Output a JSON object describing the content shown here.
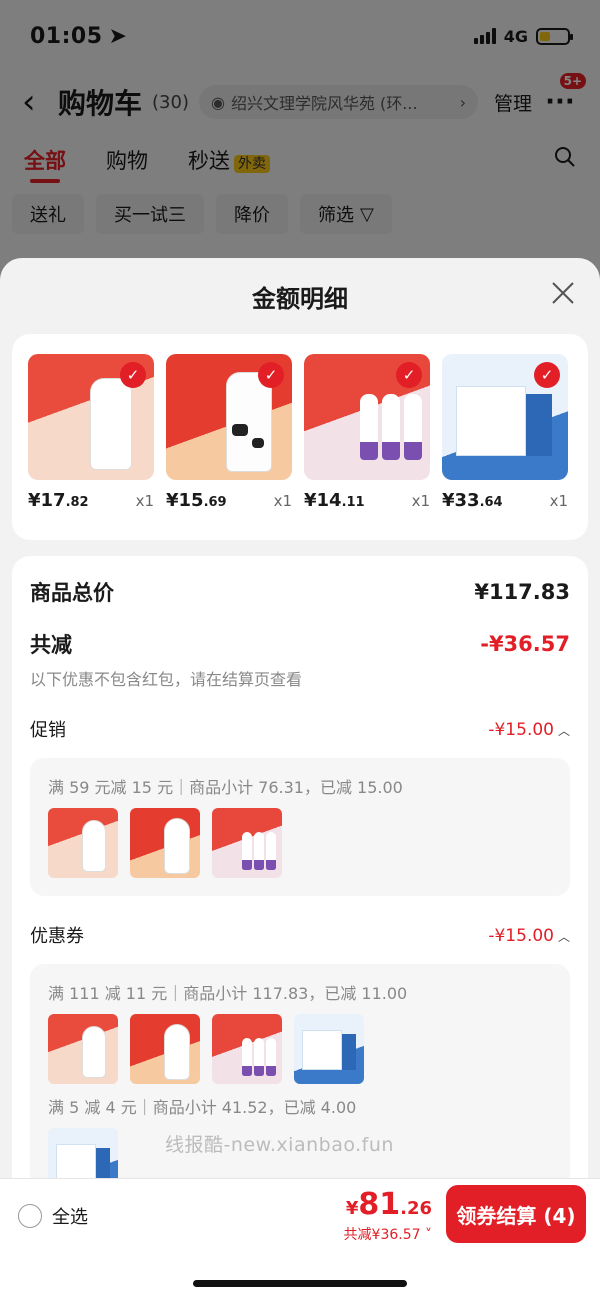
{
  "status": {
    "time": "01:05",
    "network": "4G"
  },
  "header": {
    "title": "购物车",
    "count": "(30)",
    "address": "绍兴文理学院风华苑 (环...",
    "manage_label": "管理",
    "more_badge": "5+"
  },
  "tabs": [
    {
      "label": "全部",
      "active": true
    },
    {
      "label": "购物",
      "active": false
    },
    {
      "label": "秒送",
      "tag": "外卖",
      "active": false
    }
  ],
  "filters": [
    "送礼",
    "买一试三",
    "降价",
    "筛选"
  ],
  "sheet": {
    "title": "金额明细",
    "products": [
      {
        "price_int": "¥17",
        "price_dec": ".82",
        "qty": "x1",
        "checked": true
      },
      {
        "price_int": "¥15",
        "price_dec": ".69",
        "qty": "x1",
        "checked": true
      },
      {
        "price_int": "¥14",
        "price_dec": ".11",
        "qty": "x1",
        "checked": true
      },
      {
        "price_int": "¥33",
        "price_dec": ".64",
        "qty": "x1",
        "checked": true
      }
    ],
    "total_label": "商品总价",
    "total_value": "¥117.83",
    "less_label": "共减",
    "less_value": "-¥36.57",
    "note": "以下优惠不包含红包，请在结算页查看",
    "promo": {
      "label": "促销",
      "value": "-¥15.00",
      "lines": [
        "满 59 元减 15 元｜商品小计 76.31，已减 15.00"
      ]
    },
    "coupon": {
      "label": "优惠券",
      "value": "-¥15.00",
      "line1": "满 111 减 11 元｜商品小计 117.83，已减 11.00",
      "line2": "满 5 减 4 元｜商品小计 41.52，已减 4.00"
    },
    "watermark": "线报酷-new.xianbao.fun"
  },
  "footer": {
    "select_all": "全选",
    "pay_symbol": "¥",
    "pay_int": "81",
    "pay_dec": ".26",
    "pay_off": "共减¥36.57",
    "checkout_label": "领券结算 (4)"
  },
  "colors": {
    "accent": "#e21f26",
    "badge": "#f5c518"
  }
}
